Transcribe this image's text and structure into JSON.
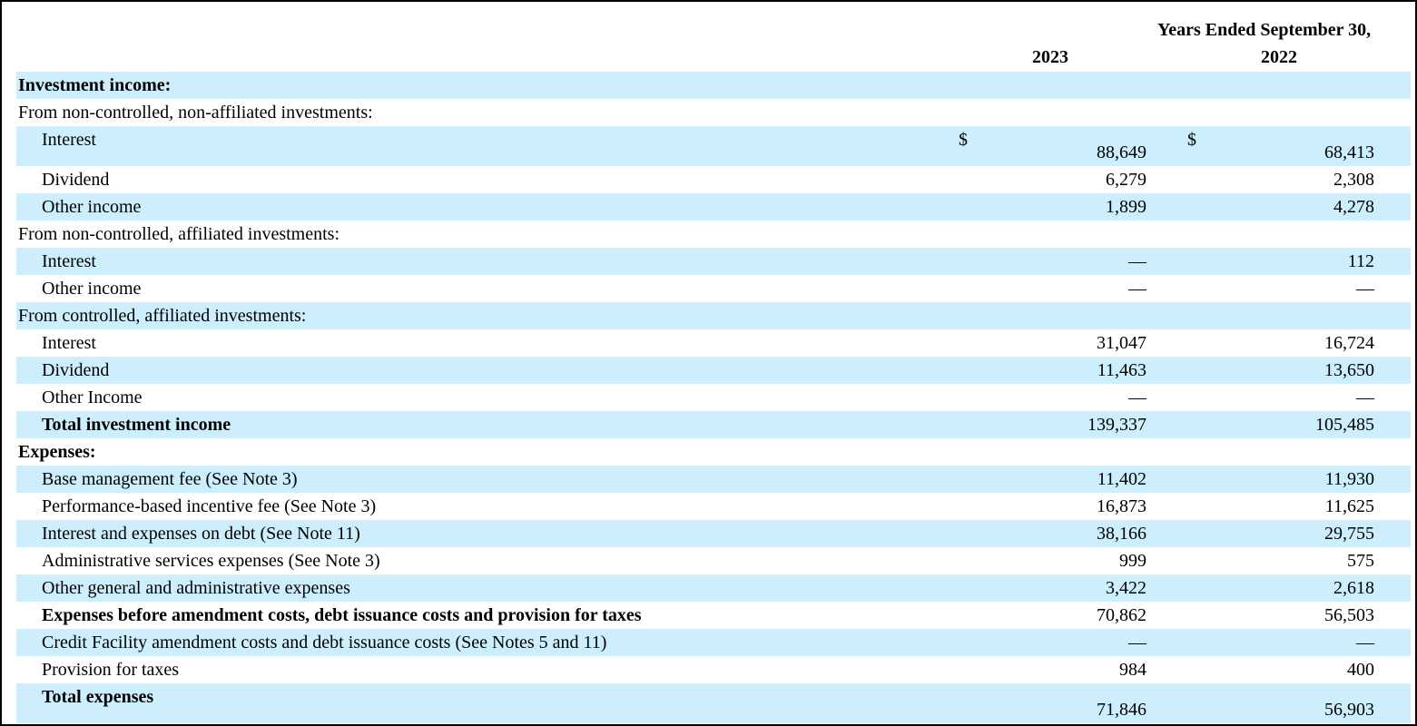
{
  "header": {
    "period_label": "Years Ended September 30,",
    "col1_year": "2023",
    "col2_year": "2022"
  },
  "currency_symbol": "$",
  "rows": [
    {
      "label": "Investment income:",
      "style": "section",
      "v1": "",
      "v2": ""
    },
    {
      "label": "From non-controlled, non-affiliated investments:",
      "style": "subsection",
      "v1": "",
      "v2": ""
    },
    {
      "label": "Interest",
      "style": "item",
      "v1": "88,649",
      "v2": "68,413",
      "currency": true
    },
    {
      "label": "Dividend",
      "style": "item",
      "v1": "6,279",
      "v2": "2,308"
    },
    {
      "label": "Other income",
      "style": "item",
      "v1": "1,899",
      "v2": "4,278"
    },
    {
      "label": "From non-controlled, affiliated investments:",
      "style": "subsection",
      "v1": "",
      "v2": ""
    },
    {
      "label": "Interest",
      "style": "item",
      "v1": "—",
      "v2": "112"
    },
    {
      "label": "Other income",
      "style": "item",
      "v1": "—",
      "v2": "—"
    },
    {
      "label": "From controlled, affiliated investments:",
      "style": "subsection",
      "v1": "",
      "v2": ""
    },
    {
      "label": "Interest",
      "style": "item",
      "v1": "31,047",
      "v2": "16,724"
    },
    {
      "label": "Dividend",
      "style": "item",
      "v1": "11,463",
      "v2": "13,650"
    },
    {
      "label": "Other Income",
      "style": "item",
      "v1": "—",
      "v2": "—"
    },
    {
      "label": "Total investment income",
      "style": "total",
      "v1": "139,337",
      "v2": "105,485"
    },
    {
      "label": "Expenses:",
      "style": "section",
      "v1": "",
      "v2": ""
    },
    {
      "label": "Base management fee (See Note 3)",
      "style": "item",
      "v1": "11,402",
      "v2": "11,930"
    },
    {
      "label": "Performance-based incentive fee (See Note 3)",
      "style": "item",
      "v1": "16,873",
      "v2": "11,625"
    },
    {
      "label": "Interest and expenses on debt (See Note 11)",
      "style": "item",
      "v1": "38,166",
      "v2": "29,755"
    },
    {
      "label": "Administrative services expenses (See Note 3)",
      "style": "item",
      "v1": "999",
      "v2": "575"
    },
    {
      "label": "Other general and administrative expenses",
      "style": "item",
      "v1": "3,422",
      "v2": "2,618"
    },
    {
      "label": "Expenses before amendment costs, debt issuance costs and provision for taxes",
      "style": "total",
      "v1": "70,862",
      "v2": "56,503"
    },
    {
      "label": "Credit Facility amendment costs and debt issuance costs (See Notes 5 and 11)",
      "style": "item",
      "v1": "—",
      "v2": "—"
    },
    {
      "label": "Provision for taxes",
      "style": "item",
      "v1": "984",
      "v2": "400"
    },
    {
      "label": "Total expenses",
      "style": "total",
      "v1": "71,846",
      "v2": "56,903"
    }
  ]
}
